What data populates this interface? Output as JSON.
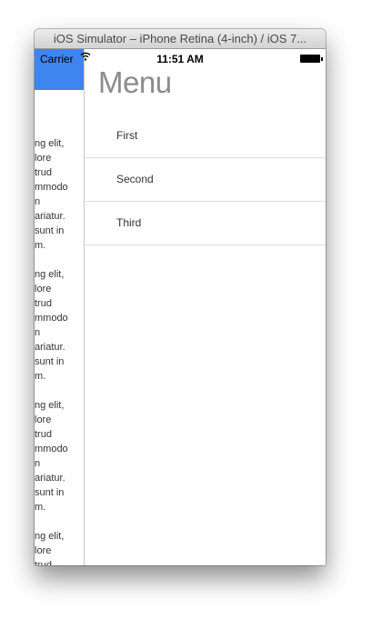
{
  "window": {
    "title": "iOS Simulator – iPhone Retina (4-inch) / iOS 7..."
  },
  "status_bar": {
    "carrier": "Carrier",
    "time": "11:51 AM"
  },
  "background_text": {
    "paragraphs": [
      {
        "lines": [
          "ng elit,",
          "lore",
          "trud",
          "mmodo",
          "n",
          "ariatur.",
          "sunt in",
          "m."
        ]
      },
      {
        "lines": [
          "ng elit,",
          "lore",
          "trud",
          "mmodo",
          "n",
          "ariatur.",
          "sunt in",
          "m."
        ]
      },
      {
        "lines": [
          "ng elit,",
          "lore",
          "trud",
          "mmodo",
          "n",
          "ariatur.",
          "sunt in",
          "m."
        ]
      },
      {
        "lines": [
          "ng elit,",
          "lore",
          "trud"
        ]
      }
    ]
  },
  "menu": {
    "title": "Menu",
    "items": [
      {
        "label": "First"
      },
      {
        "label": "Second"
      },
      {
        "label": "Third"
      }
    ]
  }
}
